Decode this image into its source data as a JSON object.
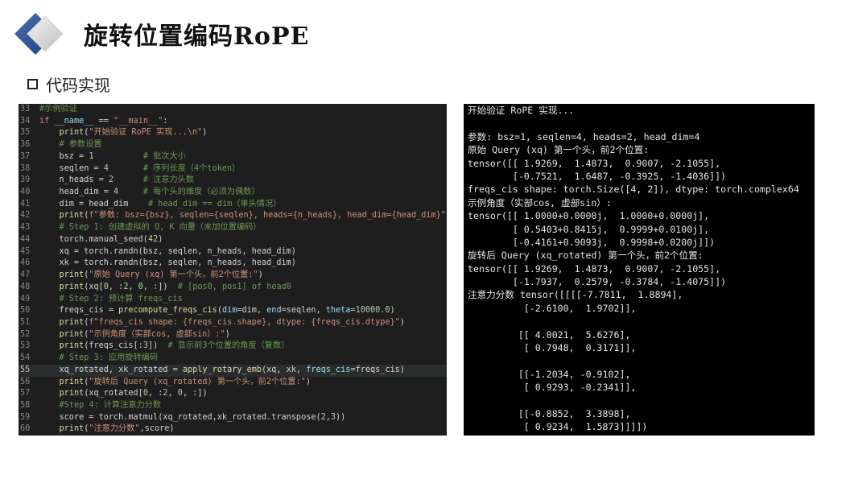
{
  "header": {
    "title": "旋转位置编码RoPE",
    "section_label": "代码实现"
  },
  "colors": {
    "editor_bg": "#1e1e1e",
    "terminal_bg": "#000000",
    "keyword": "#c586c0",
    "function": "#dcdcaa",
    "string": "#ce9178",
    "comment": "#6a9955"
  },
  "editor": {
    "active_line": "55",
    "lines": [
      {
        "n": "33",
        "tokens": [
          [
            "cm",
            "#示例验证"
          ]
        ]
      },
      {
        "n": "34",
        "tokens": [
          [
            "kw",
            "if "
          ],
          [
            "var",
            "__name__"
          ],
          [
            "plain",
            " == "
          ],
          [
            "str",
            "\"__main__\""
          ],
          [
            "plain",
            ":"
          ]
        ]
      },
      {
        "n": "35",
        "tokens": [
          [
            "plain",
            "    "
          ],
          [
            "fn",
            "print"
          ],
          [
            "plain",
            "("
          ],
          [
            "str",
            "\"开始验证 RoPE 实现...\\n\""
          ],
          [
            "plain",
            ")"
          ]
        ]
      },
      {
        "n": "36",
        "tokens": [
          [
            "plain",
            "    "
          ],
          [
            "cm",
            "# 参数设置"
          ]
        ]
      },
      {
        "n": "37",
        "tokens": [
          [
            "plain",
            "    bsz = "
          ],
          [
            "num",
            "1"
          ],
          [
            "plain",
            "          "
          ],
          [
            "cm",
            "# 批次大小"
          ]
        ]
      },
      {
        "n": "38",
        "tokens": [
          [
            "plain",
            "    seqlen = "
          ],
          [
            "num",
            "4"
          ],
          [
            "plain",
            "       "
          ],
          [
            "cm",
            "# 序列长度（4个token）"
          ]
        ]
      },
      {
        "n": "39",
        "tokens": [
          [
            "plain",
            "    n_heads = "
          ],
          [
            "num",
            "2"
          ],
          [
            "plain",
            "      "
          ],
          [
            "cm",
            "# 注意力头数"
          ]
        ]
      },
      {
        "n": "40",
        "tokens": [
          [
            "plain",
            "    head_dim = "
          ],
          [
            "num",
            "4"
          ],
          [
            "plain",
            "     "
          ],
          [
            "cm",
            "# 每个头的维度（必须为偶数）"
          ]
        ]
      },
      {
        "n": "41",
        "tokens": [
          [
            "plain",
            "    dim = head_dim    "
          ],
          [
            "cm",
            "# head_dim == dim（单头情况）"
          ]
        ]
      },
      {
        "n": "42",
        "tokens": [
          [
            "plain",
            "    "
          ],
          [
            "fn",
            "print"
          ],
          [
            "plain",
            "("
          ],
          [
            "str",
            "f\"参数: bsz={bsz}, seqlen={seqlen}, heads={n_heads}, head_dim={head_dim}\""
          ],
          [
            "plain",
            ")"
          ]
        ]
      },
      {
        "n": "43",
        "tokens": [
          [
            "plain",
            "    "
          ],
          [
            "cm",
            "# Step 1: 创建虚拟的 Q, K 向量（未加位置编码）"
          ]
        ]
      },
      {
        "n": "44",
        "tokens": [
          [
            "plain",
            "    torch.manual_seed("
          ],
          [
            "num",
            "42"
          ],
          [
            "plain",
            ")"
          ]
        ]
      },
      {
        "n": "45",
        "tokens": [
          [
            "plain",
            "    xq = torch.randn(bsz, seqlen, n_heads, head_dim)"
          ]
        ]
      },
      {
        "n": "46",
        "tokens": [
          [
            "plain",
            "    xk = torch.randn(bsz, seqlen, n_heads, head_dim)"
          ]
        ]
      },
      {
        "n": "47",
        "tokens": [
          [
            "plain",
            "    "
          ],
          [
            "fn",
            "print"
          ],
          [
            "plain",
            "("
          ],
          [
            "str",
            "\"原始 Query (xq) 第一个头，前2个位置:\""
          ],
          [
            "plain",
            ")"
          ]
        ]
      },
      {
        "n": "48",
        "tokens": [
          [
            "plain",
            "    "
          ],
          [
            "fn",
            "print"
          ],
          [
            "plain",
            "(xq["
          ],
          [
            "num",
            "0"
          ],
          [
            "plain",
            ", :"
          ],
          [
            "num",
            "2"
          ],
          [
            "plain",
            ", "
          ],
          [
            "num",
            "0"
          ],
          [
            "plain",
            ", :])  "
          ],
          [
            "cm",
            "# [pos0, pos1] of head0"
          ]
        ]
      },
      {
        "n": "49",
        "tokens": [
          [
            "plain",
            "    "
          ],
          [
            "cm",
            "# Step 2: 预计算 freqs_cis"
          ]
        ]
      },
      {
        "n": "50",
        "tokens": [
          [
            "plain",
            "    freqs_cis = "
          ],
          [
            "fn",
            "precompute_freqs_cis"
          ],
          [
            "plain",
            "("
          ],
          [
            "var",
            "dim"
          ],
          [
            "plain",
            "=dim, "
          ],
          [
            "var",
            "end"
          ],
          [
            "plain",
            "=seqlen, "
          ],
          [
            "var",
            "theta"
          ],
          [
            "plain",
            "="
          ],
          [
            "num",
            "10000.0"
          ],
          [
            "plain",
            ")"
          ]
        ]
      },
      {
        "n": "51",
        "tokens": [
          [
            "plain",
            "    "
          ],
          [
            "fn",
            "print"
          ],
          [
            "plain",
            "("
          ],
          [
            "str",
            "f\"freqs_cis shape: {freqs_cis.shape}, dtype: {freqs_cis.dtype}\""
          ],
          [
            "plain",
            ")"
          ]
        ]
      },
      {
        "n": "52",
        "tokens": [
          [
            "plain",
            "    "
          ],
          [
            "fn",
            "print"
          ],
          [
            "plain",
            "("
          ],
          [
            "str",
            "\"示例角度（实部cos, 虚部sin）:\""
          ],
          [
            "plain",
            ")"
          ]
        ]
      },
      {
        "n": "53",
        "tokens": [
          [
            "plain",
            "    "
          ],
          [
            "fn",
            "print"
          ],
          [
            "plain",
            "(freqs_cis[:"
          ],
          [
            "num",
            "3"
          ],
          [
            "plain",
            "])  "
          ],
          [
            "cm",
            "# 显示前3个位置的角度（复数）"
          ]
        ]
      },
      {
        "n": "54",
        "tokens": [
          [
            "plain",
            "    "
          ],
          [
            "cm",
            "# Step 3: 应用旋转编码"
          ]
        ]
      },
      {
        "n": "55",
        "tokens": [
          [
            "plain",
            "    xq_rotated, xk_rotated = "
          ],
          [
            "fn",
            "apply_rotary_emb"
          ],
          [
            "plain",
            "(xq, xk, "
          ],
          [
            "var",
            "freqs_cis"
          ],
          [
            "plain",
            "=freqs_cis)"
          ]
        ]
      },
      {
        "n": "56",
        "tokens": [
          [
            "plain",
            "    "
          ],
          [
            "fn",
            "print"
          ],
          [
            "plain",
            "("
          ],
          [
            "str",
            "\"旋转后 Query (xq_rotated) 第一个头，前2个位置:\""
          ],
          [
            "plain",
            ")"
          ]
        ]
      },
      {
        "n": "57",
        "tokens": [
          [
            "plain",
            "    "
          ],
          [
            "fn",
            "print"
          ],
          [
            "plain",
            "(xq_rotated["
          ],
          [
            "num",
            "0"
          ],
          [
            "plain",
            ", :"
          ],
          [
            "num",
            "2"
          ],
          [
            "plain",
            ", "
          ],
          [
            "num",
            "0"
          ],
          [
            "plain",
            ", :])"
          ]
        ]
      },
      {
        "n": "58",
        "tokens": [
          [
            "plain",
            "    "
          ],
          [
            "cm",
            "#Step 4: 计算注意力分数"
          ]
        ]
      },
      {
        "n": "59",
        "tokens": [
          [
            "plain",
            "    score = torch.matmul(xq_rotated,xk_rotated.transpose("
          ],
          [
            "num",
            "2"
          ],
          [
            "plain",
            ","
          ],
          [
            "num",
            "3"
          ],
          [
            "plain",
            "))"
          ]
        ]
      },
      {
        "n": "60",
        "tokens": [
          [
            "plain",
            "    "
          ],
          [
            "fn",
            "print"
          ],
          [
            "plain",
            "("
          ],
          [
            "str",
            "\"注意力分数\""
          ],
          [
            "plain",
            ",score)"
          ]
        ]
      }
    ]
  },
  "terminal": {
    "lines": [
      "开始验证 RoPE 实现...",
      "",
      "参数: bsz=1, seqlen=4, heads=2, head_dim=4",
      "原始 Query (xq) 第一个头，前2个位置:",
      "tensor([[ 1.9269,  1.4873,  0.9007, -2.1055],",
      "        [-0.7521,  1.6487, -0.3925, -1.4036]])",
      "freqs_cis shape: torch.Size([4, 2]), dtype: torch.complex64",
      "示例角度（实部cos, 虚部sin）:",
      "tensor([[ 1.0000+0.0000j,  1.0000+0.0000j],",
      "        [ 0.5403+0.8415j,  0.9999+0.0100j],",
      "        [-0.4161+0.9093j,  0.9998+0.0200j]])",
      "旋转后 Query (xq_rotated) 第一个头，前2个位置:",
      "tensor([[ 1.9269,  1.4873,  0.9007, -2.1055],",
      "        [-1.7937,  0.2579, -0.3784, -1.4075]])",
      "注意力分数 tensor([[[[-7.7811,  1.8894],",
      "          [-2.6100,  1.9702]],",
      "",
      "         [[ 4.0021,  5.6276],",
      "          [ 0.7948,  0.3171]],",
      "",
      "         [[-1.2034, -0.9102],",
      "          [ 0.9293, -0.2341]],",
      "",
      "         [[-0.8852,  3.3898],",
      "          [ 0.9234,  1.5873]]]])"
    ]
  }
}
